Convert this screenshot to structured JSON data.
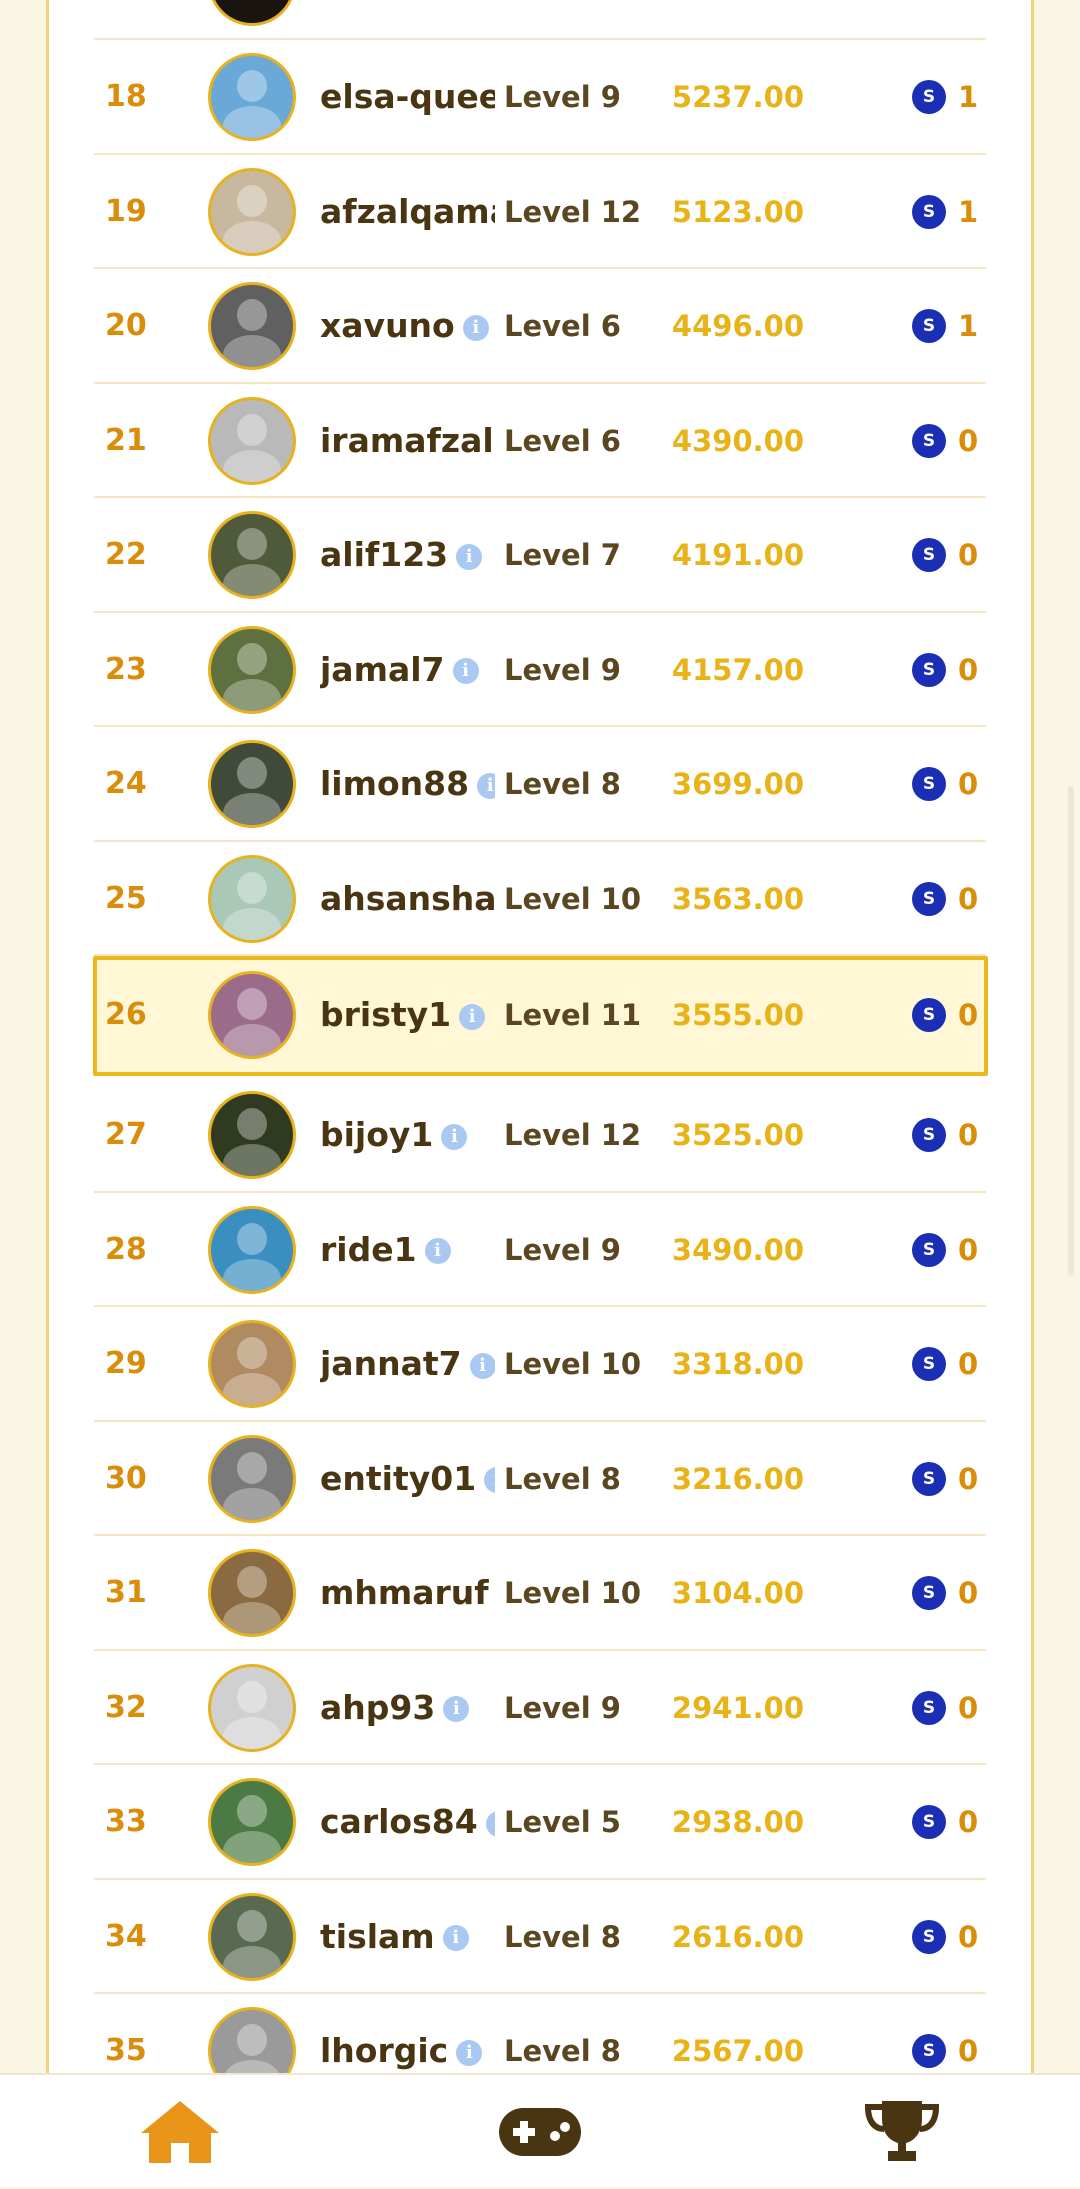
{
  "colors": {
    "rank": "#d98d0a",
    "name": "#4a3512",
    "level": "#5a4620",
    "score": "#e8b319",
    "coin": "#1a2fb3",
    "highlight_border": "#e8b81d",
    "highlight_bg": "#fff7d6",
    "nav_active": "#e8951a",
    "nav_icon": "#4a3512"
  },
  "leaderboard": {
    "rows": [
      {
        "rank": "18",
        "name": "elsa-queer",
        "level": "Level 9",
        "score": "5237.00",
        "reward": "1",
        "avatar_color": "#6aa8d8",
        "info": false
      },
      {
        "rank": "19",
        "name": "afzalqama",
        "level": "Level 12",
        "score": "5123.00",
        "reward": "1",
        "avatar_color": "#c8b8a0",
        "info": false
      },
      {
        "rank": "20",
        "name": "xavuno",
        "level": "Level 6",
        "score": "4496.00",
        "reward": "1",
        "avatar_color": "#606060",
        "info": true
      },
      {
        "rank": "21",
        "name": "iramafzal",
        "level": "Level 6",
        "score": "4390.00",
        "reward": "0",
        "avatar_color": "#b9b9b9",
        "info": true
      },
      {
        "rank": "22",
        "name": "alif123",
        "level": "Level 7",
        "score": "4191.00",
        "reward": "0",
        "avatar_color": "#4e5a3a",
        "info": true
      },
      {
        "rank": "23",
        "name": "jamal7",
        "level": "Level 9",
        "score": "4157.00",
        "reward": "0",
        "avatar_color": "#5e7040",
        "info": true
      },
      {
        "rank": "24",
        "name": "limon88",
        "level": "Level 8",
        "score": "3699.00",
        "reward": "0",
        "avatar_color": "#3f4a3a",
        "info": true
      },
      {
        "rank": "25",
        "name": "ahsanshari",
        "level": "Level 10",
        "score": "3563.00",
        "reward": "0",
        "avatar_color": "#a9c8b8",
        "info": false
      },
      {
        "rank": "26",
        "name": "bristy1",
        "level": "Level 11",
        "score": "3555.00",
        "reward": "0",
        "avatar_color": "#9b6c8a",
        "info": true,
        "highlight": true
      },
      {
        "rank": "27",
        "name": "bijoy1",
        "level": "Level 12",
        "score": "3525.00",
        "reward": "0",
        "avatar_color": "#2f3a20",
        "info": true
      },
      {
        "rank": "28",
        "name": "ride1",
        "level": "Level 9",
        "score": "3490.00",
        "reward": "0",
        "avatar_color": "#3a8ec0",
        "info": true
      },
      {
        "rank": "29",
        "name": "jannat7",
        "level": "Level 10",
        "score": "3318.00",
        "reward": "0",
        "avatar_color": "#b08a60",
        "info": true
      },
      {
        "rank": "30",
        "name": "entity01",
        "level": "Level 8",
        "score": "3216.00",
        "reward": "0",
        "avatar_color": "#7a7a7a",
        "info": true
      },
      {
        "rank": "31",
        "name": "mhmaruf",
        "level": "Level 10",
        "score": "3104.00",
        "reward": "0",
        "avatar_color": "#8a6a40",
        "info": true
      },
      {
        "rank": "32",
        "name": "ahp93",
        "level": "Level 9",
        "score": "2941.00",
        "reward": "0",
        "avatar_color": "#d0d0d0",
        "info": true
      },
      {
        "rank": "33",
        "name": "carlos84",
        "level": "Level 5",
        "score": "2938.00",
        "reward": "0",
        "avatar_color": "#4c7a44",
        "info": true
      },
      {
        "rank": "34",
        "name": "tislam",
        "level": "Level 8",
        "score": "2616.00",
        "reward": "0",
        "avatar_color": "#5a6a50",
        "info": true
      },
      {
        "rank": "35",
        "name": "lhorgic",
        "level": "Level 8",
        "score": "2567.00",
        "reward": "0",
        "avatar_color": "#9a9a9a",
        "info": true
      }
    ],
    "info_glyph": "i",
    "coin_glyph": "S"
  },
  "nav": {
    "items": [
      {
        "icon": "home-icon",
        "active": true
      },
      {
        "icon": "gamepad-icon",
        "active": false
      },
      {
        "icon": "trophy-icon",
        "active": false
      }
    ]
  }
}
